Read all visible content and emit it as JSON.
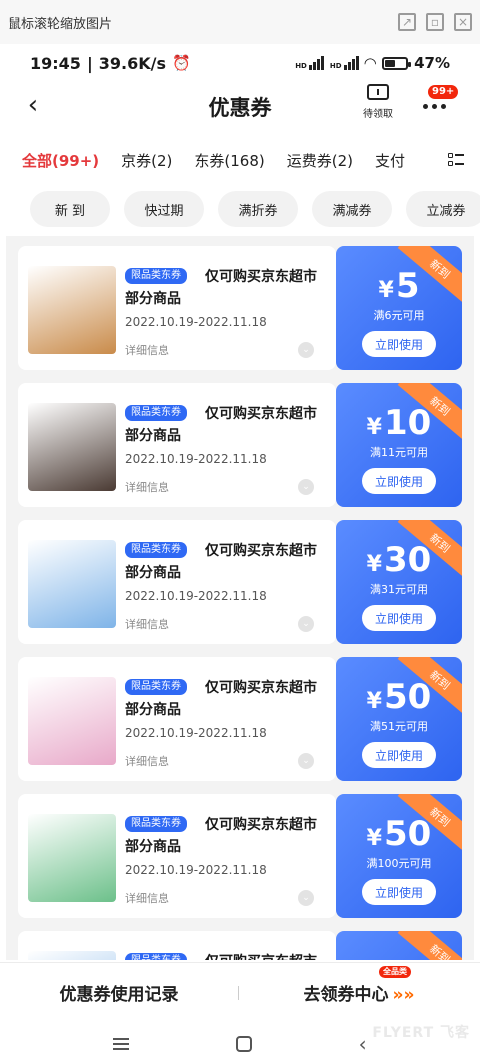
{
  "viewer": {
    "title": "鼠标滚轮缩放图片",
    "controls": [
      "open-external-icon",
      "restore-window-icon",
      "close-window-icon"
    ]
  },
  "status_bar": {
    "time": "19:45",
    "speed": "39.6K/s",
    "signal1": "HD",
    "signal2": "HD",
    "battery_percent": "47%",
    "battery_level": 0.47
  },
  "header": {
    "back_icon": "chevron-left-icon",
    "title": "优惠券",
    "pending_label": "待领取",
    "more_badge": "99+"
  },
  "tabs": [
    {
      "label": "全部(99+)",
      "active": true
    },
    {
      "label": "京券(2)",
      "active": false
    },
    {
      "label": "东券(168)",
      "active": false
    },
    {
      "label": "运费券(2)",
      "active": false
    },
    {
      "label": "支付",
      "active": false
    }
  ],
  "chips": [
    "新 到",
    "快过期",
    "满折券",
    "满减券",
    "立减券"
  ],
  "coupons": [
    {
      "tag": "限品类东券",
      "title": "仅可购买京东超市部分商品",
      "dates": "2022.10.19-2022.11.18",
      "details": "详细信息",
      "amount": "5",
      "currency": "¥",
      "threshold": "满6元可用",
      "button": "立即使用",
      "ribbon": "新到",
      "thumb_color": "#c98b4a"
    },
    {
      "tag": "限品类东券",
      "title": "仅可购买京东超市部分商品",
      "dates": "2022.10.19-2022.11.18",
      "details": "详细信息",
      "amount": "10",
      "currency": "¥",
      "threshold": "满11元可用",
      "button": "立即使用",
      "ribbon": "新到",
      "thumb_color": "#4a3a33"
    },
    {
      "tag": "限品类东券",
      "title": "仅可购买京东超市部分商品",
      "dates": "2022.10.19-2022.11.18",
      "details": "详细信息",
      "amount": "30",
      "currency": "¥",
      "threshold": "满31元可用",
      "button": "立即使用",
      "ribbon": "新到",
      "thumb_color": "#7fb4e8"
    },
    {
      "tag": "限品类东券",
      "title": "仅可购买京东超市部分商品",
      "dates": "2022.10.19-2022.11.18",
      "details": "详细信息",
      "amount": "50",
      "currency": "¥",
      "threshold": "满51元可用",
      "button": "立即使用",
      "ribbon": "新到",
      "thumb_color": "#e8a9c9"
    },
    {
      "tag": "限品类东券",
      "title": "仅可购买京东超市部分商品",
      "dates": "2022.10.19-2022.11.18",
      "details": "详细信息",
      "amount": "50",
      "currency": "¥",
      "threshold": "满100元可用",
      "button": "立即使用",
      "ribbon": "新到",
      "thumb_color": "#6cc08a"
    },
    {
      "tag": "限品类东券",
      "title": "仅可购买京东超市部分商品",
      "dates": "",
      "details": "",
      "amount": "",
      "currency": "",
      "threshold": "",
      "button": "",
      "ribbon": "新到",
      "thumb_color": "#7fb4e8"
    }
  ],
  "bottom_bar": {
    "history_label": "优惠券使用记录",
    "center_label": "去领券中心",
    "center_badge": "全品类",
    "arrows": "»»"
  },
  "nav": {
    "menu_icon": "menu-icon",
    "home_icon": "home-icon",
    "back_icon": "back-arrow-icon"
  },
  "watermark": "FLYERT 飞客"
}
